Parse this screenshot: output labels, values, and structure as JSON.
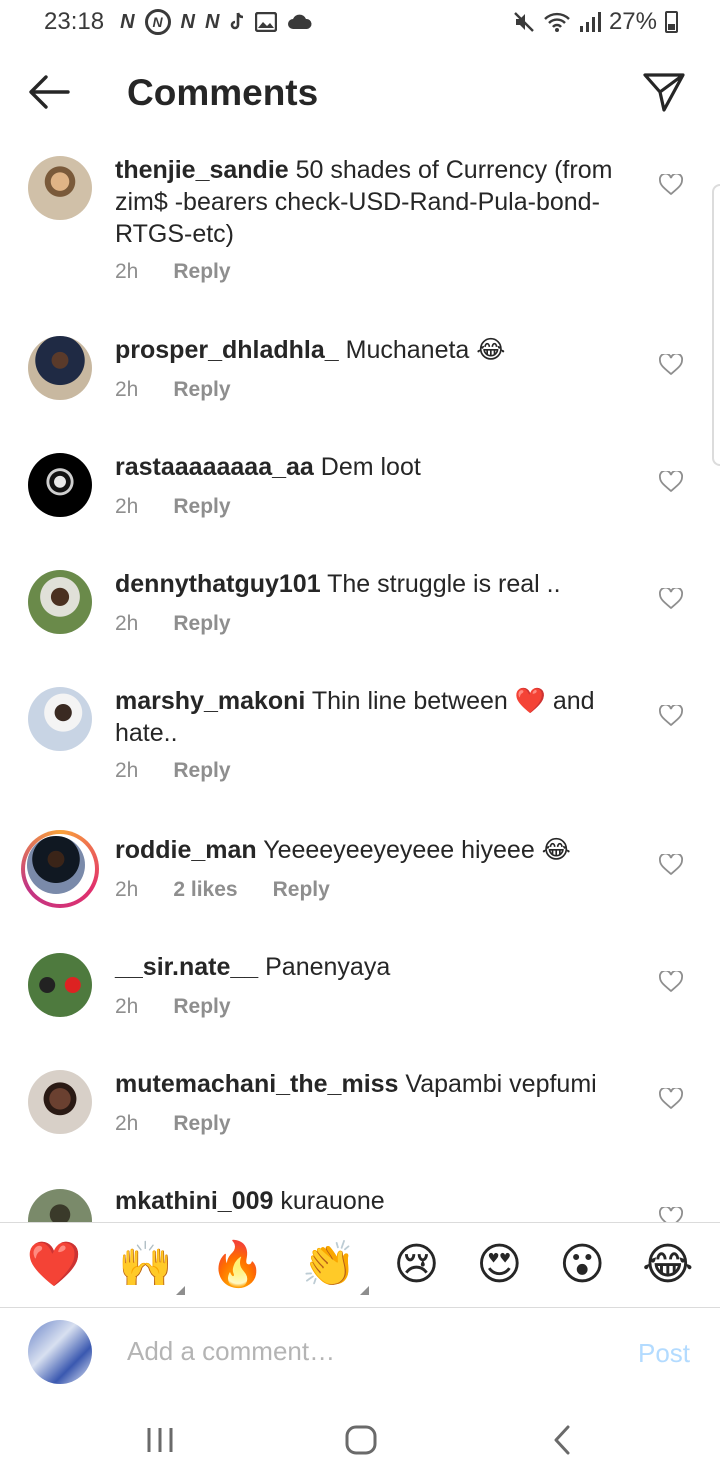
{
  "status_bar": {
    "time": "23:18",
    "notification_icons": [
      "N",
      "N",
      "N",
      "N"
    ],
    "battery": "27%",
    "icons": [
      "mute-icon",
      "wifi-icon",
      "signal-icon",
      "battery-icon",
      "tiktok-icon",
      "gallery-icon",
      "cloud-icon"
    ]
  },
  "header": {
    "title": "Comments",
    "back_icon": "arrow-left-icon",
    "share_icon": "paper-plane-icon"
  },
  "comments": [
    {
      "username": "thenjie_sandie",
      "text": "50 shades of Currency (from zim$ -bearers check-USD-Rand-Pula-bond-RTGS-etc)",
      "time": "2h",
      "reply": "Reply",
      "avatar_color": "#c9a27a"
    },
    {
      "username": "prosper_dhladhla_",
      "text": "Muchaneta 😂",
      "time": "2h",
      "reply": "Reply",
      "avatar_color": "#9b7a5a"
    },
    {
      "username": "rastaaaaaaaa_aa",
      "text": "Dem loot",
      "time": "2h",
      "reply": "Reply",
      "avatar_color": "#000000"
    },
    {
      "username": "dennythatguy101",
      "text": "The struggle is real ..",
      "time": "2h",
      "reply": "Reply",
      "avatar_color": "#8a9a6a"
    },
    {
      "username": "marshy_makoni",
      "text": "Thin line between ❤️ and hate..",
      "time": "2h",
      "reply": "Reply",
      "avatar_color": "#bcc8d8"
    },
    {
      "username": "roddie_man",
      "text": "Yeeeeyeeyeyeee hiyeee 😂",
      "time": "2h",
      "likes": "2 likes",
      "reply": "Reply",
      "avatar_color": "#2a3a6a"
    },
    {
      "username": "__sir.nate__",
      "text": "Panenyaya",
      "time": "2h",
      "reply": "Reply",
      "avatar_color": "#5a7a4a"
    },
    {
      "username": "mutemachani_the_miss",
      "text": "Vapambi vepfumi",
      "time": "2h",
      "reply": "Reply",
      "avatar_color": "#b8a898"
    },
    {
      "username": "mkathini_009",
      "text": "kurauone",
      "time": "",
      "reply": "",
      "avatar_color": "#6a7a5a"
    }
  ],
  "emoji_bar": [
    "❤️",
    "🙌",
    "🔥",
    "👏",
    "😢",
    "😍",
    "😮",
    "😂"
  ],
  "comment_input": {
    "placeholder": "Add a comment…",
    "post_label": "Post"
  },
  "colors": {
    "username": "#262626",
    "meta": "#8e8e8e",
    "post_disabled": "#b3dbff",
    "divider": "#dbdbdb"
  }
}
